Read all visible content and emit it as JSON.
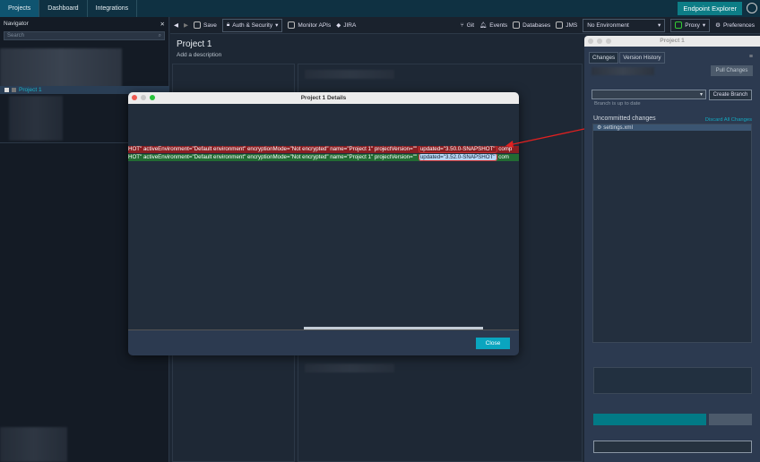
{
  "topbar": {
    "tabs": [
      "Projects",
      "Dashboard",
      "Integrations"
    ],
    "endpoint_explorer": "Endpoint Explorer"
  },
  "toolbar": {
    "save": "Save",
    "auth": "Auth & Security",
    "monitor": "Monitor APIs",
    "jira": "JIRA",
    "git": "Git",
    "events": "Events",
    "databases": "Databases",
    "jms": "JMS",
    "environment": "No Environment",
    "proxy": "Proxy",
    "preferences": "Preferences"
  },
  "navigator": {
    "title": "Navigator",
    "search_placeholder": "Search",
    "selected_project": "Project 1"
  },
  "main": {
    "title": "Project 1",
    "description": "Add a description"
  },
  "modal": {
    "title": "Project 1 Details",
    "removed_prefix": "HOT\" activeEnvironment=\"Default environment\" encryptionMode=\"Not encrypted\" name=\"Project 1\" projectVersion=\"\" ",
    "removed_hl": "updated=\"3.50.0-SNAPSHOT\"",
    "removed_suffix": " comp",
    "added_prefix": "HOT\" activeEnvironment=\"Default environment\" encryptionMode=\"Not encrypted\" name=\"Project 1\" projectVersion=\"\" ",
    "added_hl": "updated=\"3.52.0-SNAPSHOT\"",
    "added_suffix": " com",
    "close": "Close"
  },
  "git": {
    "title": "Project 1",
    "tabs": [
      "Changes",
      "Version History"
    ],
    "pull": "Pull Changes",
    "create_branch": "Create Branch",
    "branch_status": "Branch is up to date",
    "uncommitted": "Uncommitted changes",
    "discard": "Discard All Changes",
    "files": [
      "settings.xml"
    ]
  }
}
